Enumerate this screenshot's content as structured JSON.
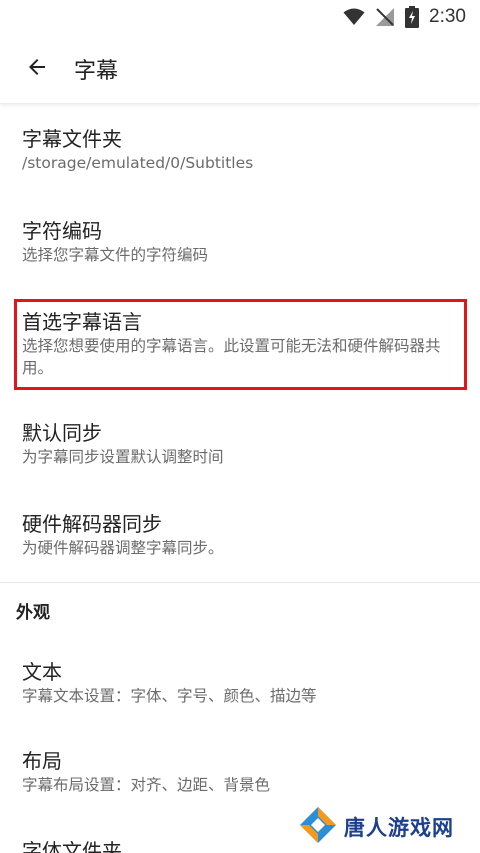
{
  "status_bar": {
    "time": "2:30",
    "icons": [
      "wifi-icon",
      "no-signal-icon",
      "battery-charging-icon"
    ]
  },
  "app_bar": {
    "back_icon": "arrow-back-icon",
    "title": "字幕"
  },
  "preferences": [
    {
      "title": "字幕文件夹",
      "summary": "/storage/emulated/0/Subtitles"
    },
    {
      "title": "字符编码",
      "summary": "选择您字幕文件的字符编码"
    },
    {
      "title": "首选字幕语言",
      "summary": "选择您想要使用的字幕语言。此设置可能无法和硬件解码器共用。"
    },
    {
      "title": "默认同步",
      "summary": "为字幕同步设置默认调整时间"
    },
    {
      "title": "硬件解码器同步",
      "summary": "为硬件解码器调整字幕同步。"
    }
  ],
  "appearance": {
    "category": "外观",
    "items": [
      {
        "title": "文本",
        "summary": "字幕文本设置：字体、字号、颜色、描边等"
      },
      {
        "title": "布局",
        "summary": "字幕布局设置：对齐、边距、背景色"
      },
      {
        "title": "字体文件夹",
        "summary": ""
      }
    ]
  },
  "watermark": {
    "text": "唐人游戏网",
    "logo_icon": "diamond-logo-icon"
  },
  "colors": {
    "highlight": "#e3141a",
    "watermark_text": "#1d3f8f",
    "logo_orange": "#f39a1e",
    "logo_blue": "#2a8fd6"
  }
}
